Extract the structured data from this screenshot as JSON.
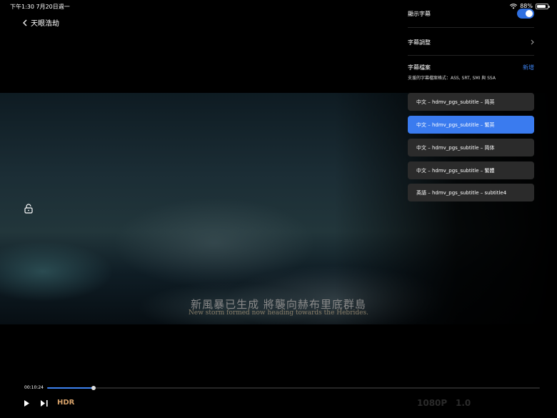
{
  "status": {
    "time_date": "下午1:30   7月20日週一",
    "battery_pct": "88%",
    "battery_level": 0.88
  },
  "nav": {
    "back_label": "天眼浩劫"
  },
  "video": {
    "subtitle_zh": "新風暴已生成 將襲向赫布里底群島",
    "subtitle_en": "New storm formed now heading towards the Hebrides."
  },
  "panel": {
    "show_subtitles_label": "顯示字幕",
    "show_subtitles_on": true,
    "adjust_label": "字幕調整",
    "files_label": "字幕檔案",
    "add_label": "新增",
    "files_sub": "支援的字幕檔案格式：ASS, SRT, SMI 與 SSA",
    "tracks": [
      {
        "label": "中文 – hdmv_pgs_subtitle – 简英",
        "selected": false
      },
      {
        "label": "中文 – hdmv_pgs_subtitle – 繁英",
        "selected": true
      },
      {
        "label": "中文 – hdmv_pgs_subtitle – 简体",
        "selected": false
      },
      {
        "label": "中文 – hdmv_pgs_subtitle – 繁體",
        "selected": false
      },
      {
        "label": "英語 – hdmv_pgs_subtitle – subtitle4",
        "selected": false
      }
    ]
  },
  "player": {
    "elapsed": "00:10:24",
    "progress": 0.094,
    "hdr_label": "HDR",
    "resolution_label": "1080P",
    "speed_label": "1.0"
  },
  "colors": {
    "accent": "#3a7bef",
    "hdr": "#d9a36a"
  }
}
